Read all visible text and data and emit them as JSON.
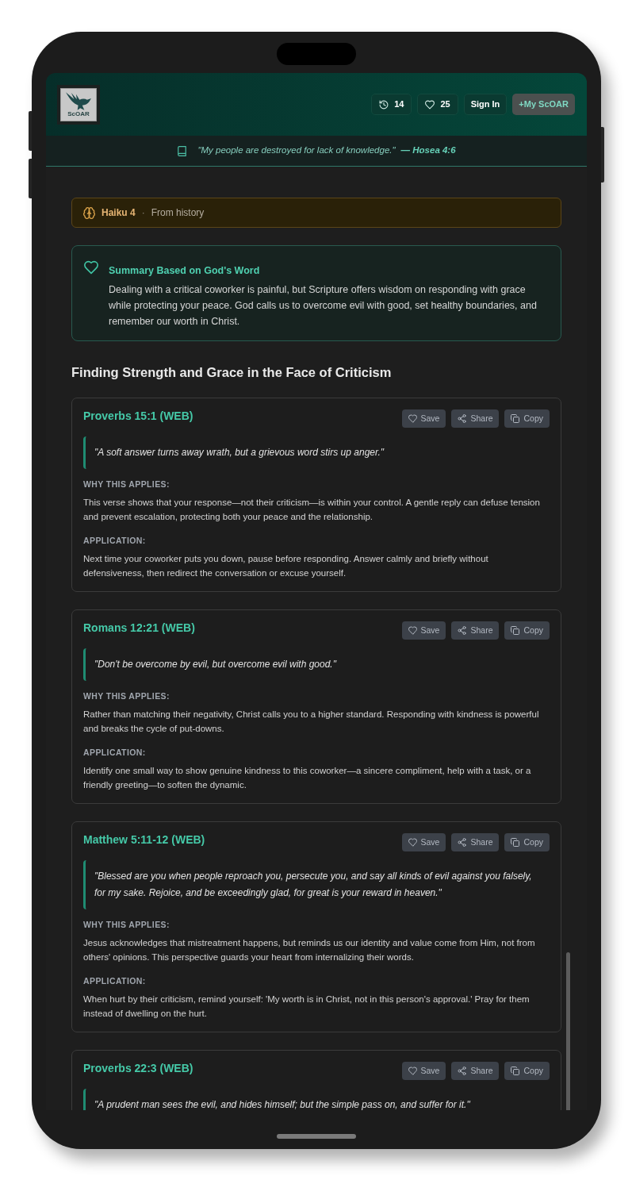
{
  "header": {
    "logo_text": "ScOAR",
    "buttons": [
      {
        "kind": "history",
        "label": "14"
      },
      {
        "kind": "favorites",
        "label": "25"
      },
      {
        "kind": "sign_in",
        "label": "Sign In"
      },
      {
        "kind": "primary",
        "label": "+My ScOAR"
      }
    ]
  },
  "verse_banner": {
    "quote": "\"My people are destroyed for lack of knowledge.\"",
    "reference": "— Hosea 4:6"
  },
  "model_bar": {
    "model": "Haiku 4",
    "separator": "·",
    "source": "From history"
  },
  "summary": {
    "title": "Summary Based on God's Word",
    "text": "Dealing with a critical coworker is painful, but Scripture offers wisdom on responding with grace while protecting your peace. God calls us to overcome evil with good, set healthy boundaries, and remember our worth in Christ."
  },
  "heading": "Finding Strength and Grace in the Face of Criticism",
  "verses": [
    {
      "reference": "Proverbs 15:1 (WEB)",
      "actions": [
        {
          "kind": "save",
          "label": "Save"
        },
        {
          "kind": "share",
          "label": "Share"
        },
        {
          "kind": "copy",
          "label": "Copy"
        }
      ],
      "quote": "\"A soft answer turns away wrath, but a grievous word stirs up anger.\"",
      "why_label": "WHY THIS APPLIES:",
      "why": "This verse shows that your response—not their criticism—is within your control. A gentle reply can defuse tension and prevent escalation, protecting both your peace and the relationship.",
      "application_label": "APPLICATION:",
      "application": "Next time your coworker puts you down, pause before responding. Answer calmly and briefly without defensiveness, then redirect the conversation or excuse yourself."
    },
    {
      "reference": "Romans 12:21 (WEB)",
      "actions": [
        {
          "kind": "save",
          "label": "Save"
        },
        {
          "kind": "share",
          "label": "Share"
        },
        {
          "kind": "copy",
          "label": "Copy"
        }
      ],
      "quote": "\"Don't be overcome by evil, but overcome evil with good.\"",
      "why_label": "WHY THIS APPLIES:",
      "why": "Rather than matching their negativity, Christ calls you to a higher standard. Responding with kindness is powerful and breaks the cycle of put-downs.",
      "application_label": "APPLICATION:",
      "application": "Identify one small way to show genuine kindness to this coworker—a sincere compliment, help with a task, or a friendly greeting—to soften the dynamic."
    },
    {
      "reference": "Matthew 5:11-12 (WEB)",
      "actions": [
        {
          "kind": "save",
          "label": "Save"
        },
        {
          "kind": "share",
          "label": "Share"
        },
        {
          "kind": "copy",
          "label": "Copy"
        }
      ],
      "quote": "\"Blessed are you when people reproach you, persecute you, and say all kinds of evil against you falsely, for my sake. Rejoice, and be exceedingly glad, for great is your reward in heaven.\"",
      "why_label": "WHY THIS APPLIES:",
      "why": "Jesus acknowledges that mistreatment happens, but reminds us our identity and value come from Him, not from others' opinions. This perspective guards your heart from internalizing their words.",
      "application_label": "APPLICATION:",
      "application": "When hurt by their criticism, remind yourself: 'My worth is in Christ, not in this person's approval.' Pray for them instead of dwelling on the hurt."
    },
    {
      "reference": "Proverbs 22:3 (WEB)",
      "actions": [
        {
          "kind": "save",
          "label": "Save"
        },
        {
          "kind": "share",
          "label": "Share"
        },
        {
          "kind": "copy",
          "label": "Copy"
        }
      ],
      "quote": "\"A prudent man sees the evil, and hides himself; but the simple pass on, and suffer for it.\""
    }
  ]
}
